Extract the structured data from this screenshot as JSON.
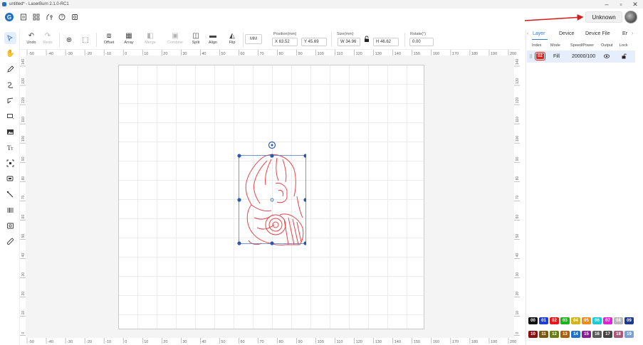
{
  "window": {
    "title": "untitled* - LaserBurn 2.1.0-RC1"
  },
  "device_button": {
    "label": "Unknown"
  },
  "toolbar": {
    "undo": "Undo",
    "redo": "Redo",
    "offset": "Offset",
    "array": "Array",
    "merge": "Merge",
    "combine": "Combine",
    "split": "Split",
    "align": "Align",
    "flip": "Flip",
    "unit": "MM",
    "position_label": "Position(mm)",
    "pos_x": "X 63.52",
    "pos_y": "Y 45.69",
    "size_label": "Size(mm)",
    "size_w": "W 34.96",
    "size_h": "H 46.62",
    "rotate_label": "Rotate(°)",
    "rotate": "0.00"
  },
  "ruler": {
    "h_ticks": [
      "-50",
      "-40",
      "-30",
      "-20",
      "-10",
      "0",
      "10",
      "20",
      "30",
      "40",
      "50",
      "60",
      "70",
      "80",
      "90",
      "100",
      "110",
      "120",
      "130",
      "140",
      "150",
      "160",
      "170",
      "180",
      "190",
      "200"
    ],
    "v_ticks": [
      "140",
      "130",
      "120",
      "110",
      "100",
      "90",
      "80",
      "70",
      "60",
      "50",
      "40",
      "30",
      "20",
      "10",
      "0"
    ]
  },
  "right_panel": {
    "tabs": [
      "Layer",
      "Device",
      "Device File",
      "Er"
    ],
    "columns": {
      "index": "Index",
      "mode": "Mode",
      "speed_power": "Speed/Power",
      "output": "Output",
      "lock": "Lock"
    },
    "layer_row": {
      "index": "02",
      "mode": "Fill",
      "speed_power": "20000/100",
      "color": "#e11b1b"
    }
  },
  "palette": {
    "row1": [
      {
        "label": "00",
        "color": "#111111"
      },
      {
        "label": "01",
        "color": "#1d3fd0"
      },
      {
        "label": "02",
        "color": "#e11b1b"
      },
      {
        "label": "03",
        "color": "#1cb51c"
      },
      {
        "label": "04",
        "color": "#d2b41c"
      },
      {
        "label": "05",
        "color": "#f08a1f"
      },
      {
        "label": "06",
        "color": "#1fc9d6"
      },
      {
        "label": "07",
        "color": "#e022d8"
      },
      {
        "label": "08",
        "color": "#b9b9b9"
      },
      {
        "label": "09",
        "color": "#1d3a8f"
      }
    ],
    "row2": [
      {
        "label": "10",
        "color": "#8a1010"
      },
      {
        "label": "11",
        "color": "#7a5a0a"
      },
      {
        "label": "12",
        "color": "#6a7d10"
      },
      {
        "label": "13",
        "color": "#a8600a"
      },
      {
        "label": "14",
        "color": "#1e73c9"
      },
      {
        "label": "15",
        "color": "#8a1a9a"
      },
      {
        "label": "16",
        "color": "#5a5a5a"
      },
      {
        "label": "17",
        "color": "#444444"
      },
      {
        "label": "18",
        "color": "#a65a7a"
      },
      {
        "label": "19",
        "color": "#7aa0d8"
      }
    ]
  }
}
